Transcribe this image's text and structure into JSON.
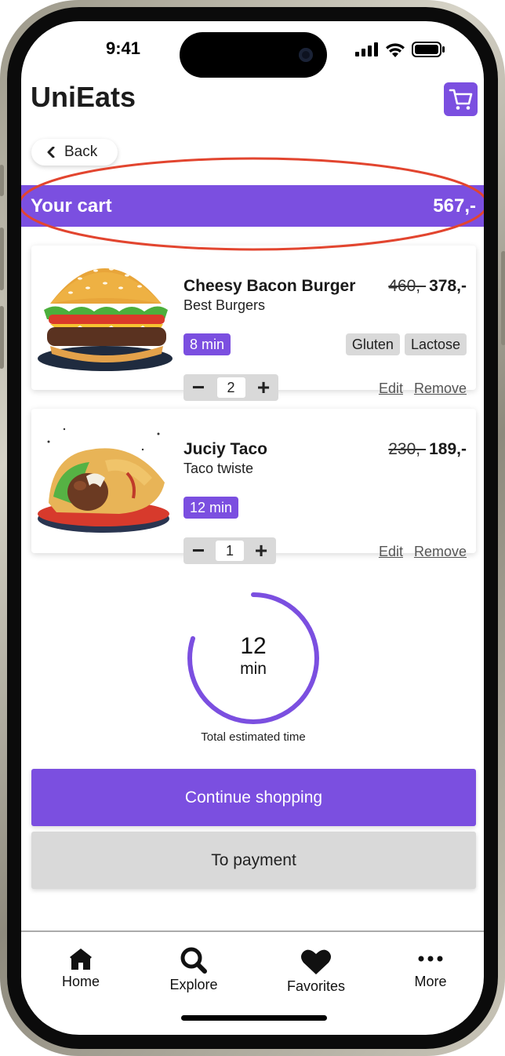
{
  "status_bar": {
    "time": "9:41"
  },
  "header": {
    "title": "UniEats"
  },
  "back_label": "Back",
  "cart_summary": {
    "title": "Your cart",
    "total": "567,-"
  },
  "items": [
    {
      "name": "Cheesy Bacon Burger",
      "shop": "Best Burgers",
      "old_price": "460,-",
      "price": "378,-",
      "time": "8 min",
      "tags": [
        "Gluten",
        "Lactose"
      ],
      "quantity": "2",
      "edit_label": "Edit",
      "remove_label": "Remove"
    },
    {
      "name": "Juciy Taco",
      "shop": "Taco twiste",
      "old_price": "230,-",
      "price": "189,-",
      "time": "12 min",
      "tags": [],
      "quantity": "1",
      "edit_label": "Edit",
      "remove_label": "Remove"
    }
  ],
  "timer": {
    "value": "12",
    "unit": "min",
    "caption": "Total estimated time",
    "progress": 0.8
  },
  "buttons": {
    "continue": "Continue shopping",
    "payment": "To payment"
  },
  "nav": [
    {
      "label": "Home",
      "icon": "home-icon"
    },
    {
      "label": "Explore",
      "icon": "search-icon"
    },
    {
      "label": "Favorites",
      "icon": "heart-icon"
    },
    {
      "label": "More",
      "icon": "more-icon"
    }
  ],
  "colors": {
    "accent": "#7b4fe0",
    "chip": "#d9d9d9",
    "highlight": "#e2452f"
  }
}
